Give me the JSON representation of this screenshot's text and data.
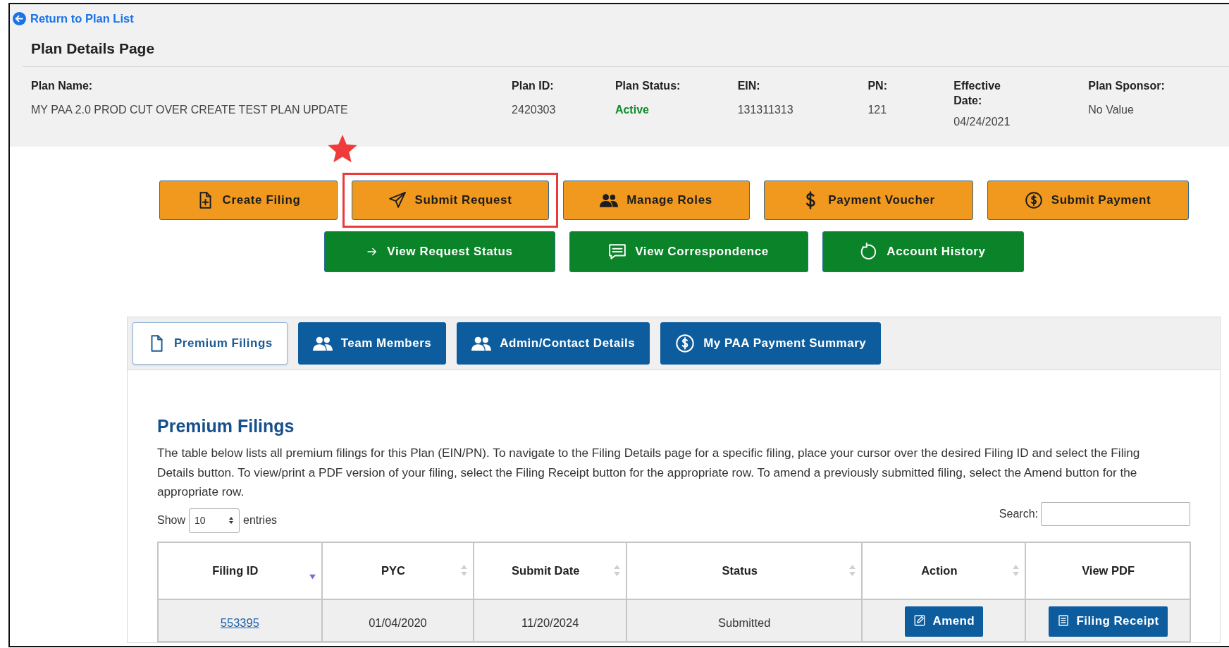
{
  "back_link": "Return to Plan List",
  "page_title": "Plan Details Page",
  "plan_fields": [
    {
      "label": "Plan Name:",
      "value": "MY PAA 2.0 PROD CUT OVER CREATE TEST PLAN UPDATE",
      "kind": "text"
    },
    {
      "label": "Plan ID:",
      "value": "2420303",
      "kind": "text"
    },
    {
      "label": "Plan Status:",
      "value": "Active",
      "kind": "status"
    },
    {
      "label": "EIN:",
      "value": "131311313",
      "kind": "text"
    },
    {
      "label": "PN:",
      "value": "121",
      "kind": "text"
    },
    {
      "label": "Effective Date:",
      "value": "04/24/2021",
      "kind": "text"
    },
    {
      "label": "Plan Sponsor:",
      "value": "No Value",
      "kind": "text"
    }
  ],
  "primary_actions": [
    {
      "label": "Create Filing",
      "highlighted": false
    },
    {
      "label": "Submit Request",
      "highlighted": true
    },
    {
      "label": "Manage Roles",
      "highlighted": false
    },
    {
      "label": "Payment Voucher",
      "highlighted": false
    },
    {
      "label": "Submit Payment",
      "highlighted": false
    }
  ],
  "secondary_actions": [
    {
      "label": "View Request Status",
      "highlighted": false
    },
    {
      "label": "View Correspondence",
      "highlighted": false
    },
    {
      "label": "Account History",
      "highlighted": false
    }
  ],
  "tabs": [
    {
      "label": "Premium Filings",
      "selected": true
    },
    {
      "label": "Team Members",
      "selected": false
    },
    {
      "label": "Admin/Contact Details",
      "selected": false
    },
    {
      "label": "My PAA Payment Summary",
      "selected": false
    }
  ],
  "section": {
    "title": "Premium Filings",
    "description": "The table below lists all premium filings for this Plan (EIN/PN). To navigate to the Filing Details page for a specific filing, place your cursor over the desired Filing ID and select the Filing Details button. To view/print a PDF version of your filing, select the Filing Receipt button for the appropriate row. To amend a previously submitted filing, select the Amend button for the appropriate row."
  },
  "length_control": {
    "show_label": "Show",
    "value": "10",
    "entries_label": "entries"
  },
  "search": {
    "label": "Search:"
  },
  "table": {
    "columns": [
      {
        "label": "Filing ID",
        "sortable": true,
        "sorted": true
      },
      {
        "label": "PYC",
        "sortable": true,
        "sorted": false
      },
      {
        "label": "Submit Date",
        "sortable": true,
        "sorted": false
      },
      {
        "label": "Status",
        "sortable": true,
        "sorted": false
      },
      {
        "label": "Action",
        "sortable": true,
        "sorted": false
      },
      {
        "label": "View PDF",
        "sortable": false,
        "sorted": false
      }
    ],
    "rows": [
      {
        "filing_id": "553395",
        "pyc": "01/04/2020",
        "submit_date": "11/20/2024",
        "status": "Submitted",
        "action": "Amend",
        "view_pdf": "Filing Receipt"
      }
    ]
  }
}
